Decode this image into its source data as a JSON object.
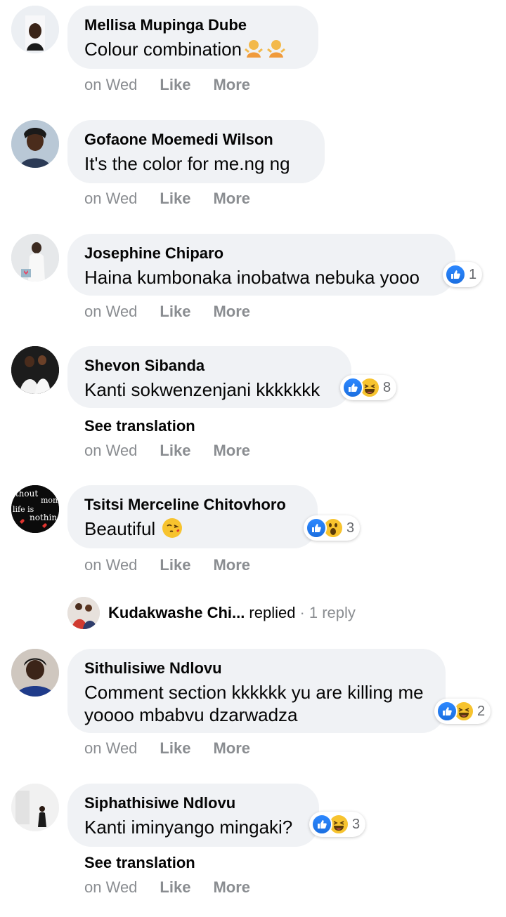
{
  "comments": [
    {
      "author": "Mellisa Mupinga Dube",
      "text": "Colour combination",
      "time": "on Wed",
      "like": "Like",
      "more": "More",
      "avatar_icon": "profile-photo-woman",
      "inline_emoji": [
        "person-shrugging-emoji",
        "person-shrugging-emoji"
      ]
    },
    {
      "author": "Gofaone Moemedi Wilson",
      "text": "It's the color for me.ng ng",
      "time": "on Wed",
      "like": "Like",
      "more": "More",
      "avatar_icon": "profile-photo-woman"
    },
    {
      "author": "Josephine Chiparo",
      "text": "Haina kumbonaka inobatwa nebuka yooo",
      "time": "on Wed",
      "like": "Like",
      "more": "More",
      "avatar_icon": "profile-photo-man",
      "reactions": [
        "like"
      ],
      "reaction_count": "1"
    },
    {
      "author": "Shevon Sibanda",
      "text": "Kanti sokwenzenjani kkkkkkk",
      "time": "on Wed",
      "like": "Like",
      "more": "More",
      "see_translation": "See translation",
      "avatar_icon": "profile-photo-couple",
      "reactions": [
        "like",
        "haha"
      ],
      "reaction_count": "8"
    },
    {
      "author": "Tsitsi Merceline Chitovhoro",
      "text": "Beautiful",
      "time": "on Wed",
      "like": "Like",
      "more": "More",
      "avatar_icon": "profile-photo-text",
      "avatar_text": [
        "ithout",
        "mom",
        "life is",
        "nothing"
      ],
      "inline_emoji": [
        "face-blowing-kiss-emoji"
      ],
      "reactions": [
        "like",
        "wow"
      ],
      "reaction_count": "3"
    },
    {
      "author": "Sithulisiwe Ndlovu",
      "text": "Comment section kkkkkk yu are killing me yoooo mbabvu dzarwadza",
      "time": "on Wed",
      "like": "Like",
      "more": "More",
      "avatar_icon": "profile-photo-woman",
      "reactions": [
        "like",
        "haha"
      ],
      "reaction_count": "2"
    },
    {
      "author": "Siphathisiwe Ndlovu",
      "text": "Kanti iminyango mingaki?",
      "time": "on Wed",
      "like": "Like",
      "more": "More",
      "see_translation": "See translation",
      "avatar_icon": "profile-photo-man",
      "reactions": [
        "like",
        "haha"
      ],
      "reaction_count": "3"
    }
  ],
  "reply_summary": {
    "name": "Kudakwashe Chi...",
    "verb": "replied",
    "count": "· 1 reply"
  },
  "colors": {
    "bubble": "#f0f2f5",
    "meta_text": "#8a8d91",
    "like_blue": "#1b74e4",
    "haha_yellow": "#f7c32e"
  }
}
